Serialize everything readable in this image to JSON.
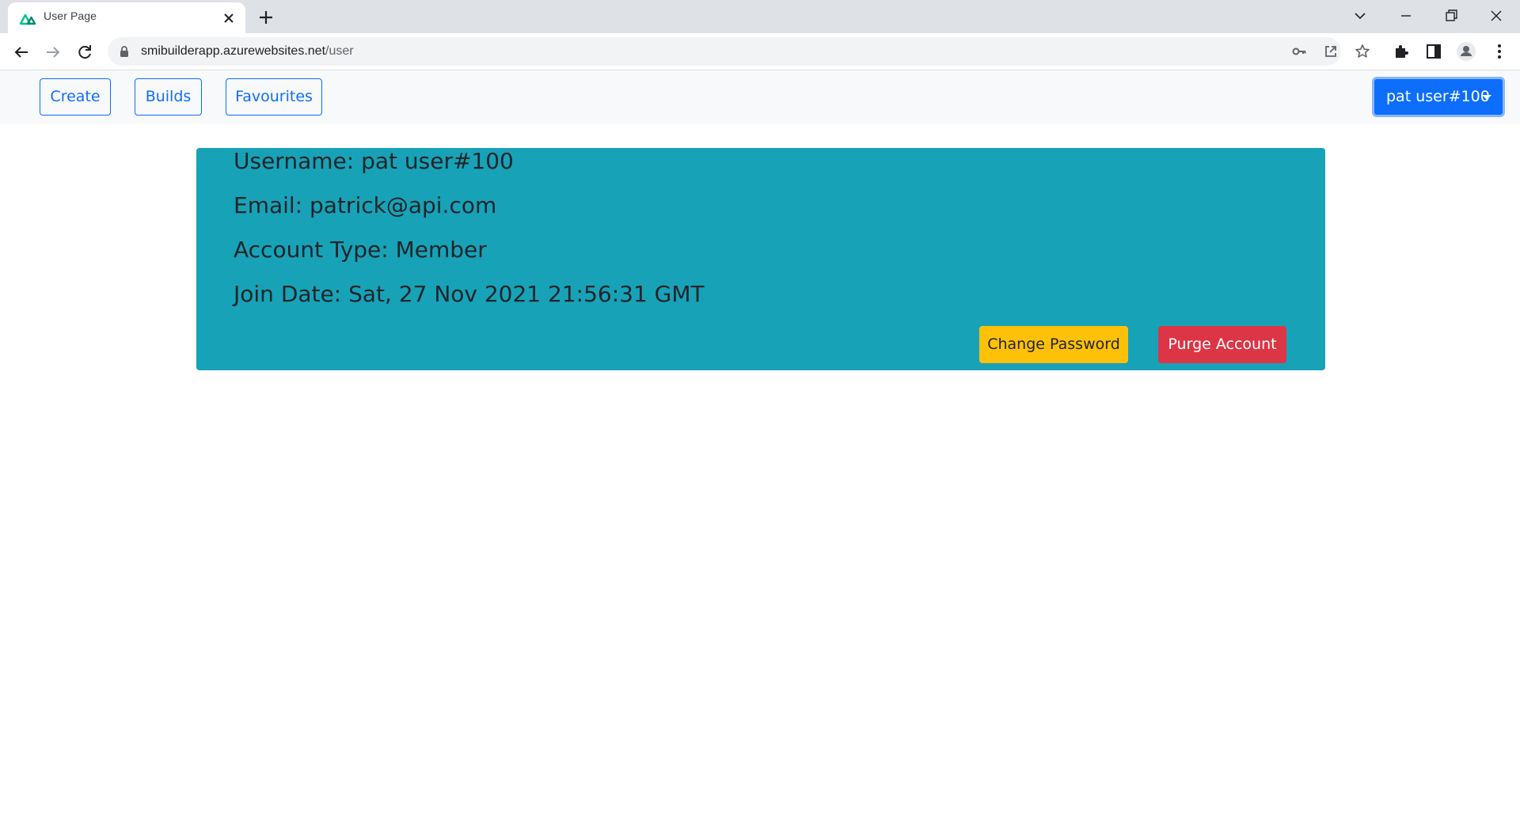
{
  "browser": {
    "tab_title": "User Page",
    "url_host": "smibuilderapp.azurewebsites.net",
    "url_path": "/user"
  },
  "navbar": {
    "links": [
      {
        "label": "Create"
      },
      {
        "label": "Builds"
      },
      {
        "label": "Favourites"
      }
    ],
    "user_menu_label": "pat user#100"
  },
  "profile": {
    "username_line": "Username: pat user#100",
    "email_line": "Email: patrick@api.com",
    "account_type_line": "Account Type: Member",
    "join_date_line": "Join Date: Sat, 27 Nov 2021 21:56:31 GMT",
    "change_password_label": "Change Password",
    "purge_account_label": "Purge Account"
  },
  "colors": {
    "primary": "#0d6efd",
    "card": "#17a2b8",
    "warning": "#ffc107",
    "danger": "#dc3545"
  }
}
